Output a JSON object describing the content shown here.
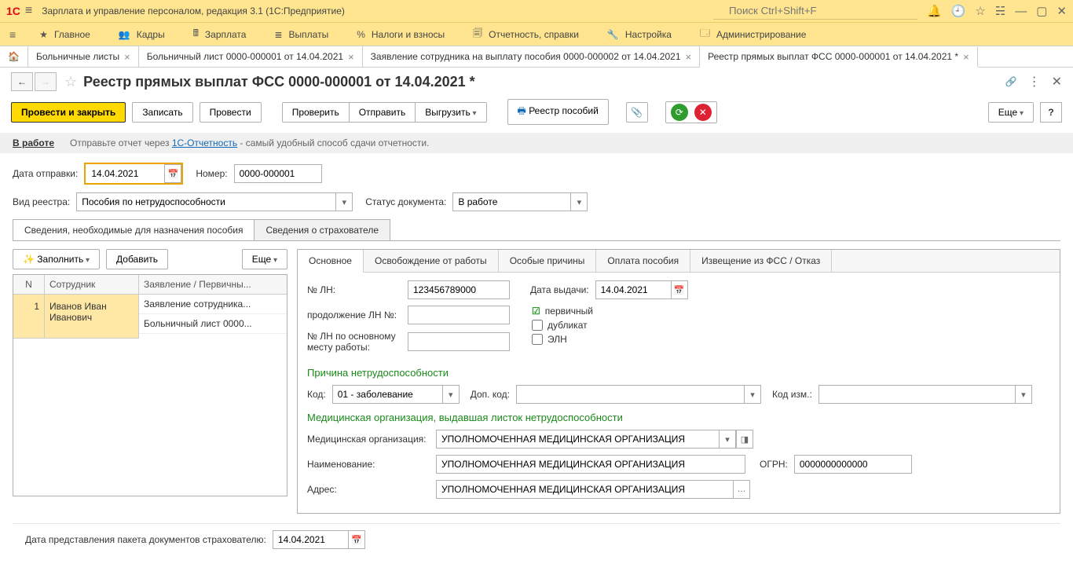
{
  "title_bar": {
    "logo": "1C",
    "app_title": "Зарплата и управление персоналом, редакция 3.1  (1С:Предприятие)",
    "search_placeholder": "Поиск Ctrl+Shift+F"
  },
  "main_menu": [
    {
      "icon": "★",
      "label": "Главное"
    },
    {
      "icon": "👥",
      "label": "Кадры"
    },
    {
      "icon": "🖩",
      "label": "Зарплата"
    },
    {
      "icon": "≣",
      "label": "Выплаты"
    },
    {
      "icon": "%",
      "label": "Налоги и взносы"
    },
    {
      "icon": "🗐",
      "label": "Отчетность, справки"
    },
    {
      "icon": "🔧",
      "label": "Настройка"
    },
    {
      "icon": "🗔",
      "label": "Администрирование"
    }
  ],
  "tabs": [
    {
      "label": "Больничные листы"
    },
    {
      "label": "Больничный лист 0000-000001 от 14.04.2021"
    },
    {
      "label": "Заявление сотрудника на выплату пособия 0000-000002 от 14.04.2021"
    },
    {
      "label": "Реестр прямых выплат ФСС 0000-000001 от 14.04.2021 *",
      "active": true
    }
  ],
  "page": {
    "title": "Реестр прямых выплат ФСС 0000-000001 от 14.04.2021 *"
  },
  "toolbar": {
    "btn_post_close": "Провести и закрыть",
    "btn_write": "Записать",
    "btn_post": "Провести",
    "btn_check": "Проверить",
    "btn_send": "Отправить",
    "btn_export": "Выгрузить",
    "btn_registry": "Реестр пособий",
    "btn_more": "Еще"
  },
  "banner": {
    "status": "В работе",
    "text_pre": "Отправьте отчет через ",
    "link": "1С-Отчетность",
    "text_post": " - самый удобный способ сдачи отчетности."
  },
  "header_form": {
    "lbl_send_date": "Дата отправки:",
    "send_date": "14.04.2021",
    "lbl_number": "Номер:",
    "number": "0000-000001",
    "lbl_registry_type": "Вид реестра:",
    "registry_type": "Пособия по нетрудоспособности",
    "lbl_doc_status": "Статус документа:",
    "doc_status": "В работе"
  },
  "section_tabs": {
    "tab1": "Сведения, необходимые для назначения пособия",
    "tab2": "Сведения о страхователе"
  },
  "left_toolbar": {
    "btn_fill": "Заполнить",
    "btn_add": "Добавить",
    "btn_more": "Еще"
  },
  "left_table": {
    "col_n": "N",
    "col_emp": "Сотрудник",
    "col_doc": "Заявление / Первичны...",
    "row_n": "1",
    "row_emp": "Иванов Иван Иванович",
    "row_doc1": "Заявление сотрудника...",
    "row_doc2": "Больничный лист 0000..."
  },
  "inner_tabs": {
    "t1": "Основное",
    "t2": "Освобождение от работы",
    "t3": "Особые причины",
    "t4": "Оплата пособия",
    "t5": "Извещение из ФСС / Отказ"
  },
  "main_form": {
    "lbl_ln": "№ ЛН:",
    "ln": "123456789000",
    "lbl_issue_date": "Дата выдачи:",
    "issue_date": "14.04.2021",
    "lbl_cont_ln": "продолжение ЛН №:",
    "lbl_main_ln": "№ ЛН по основному месту работы:",
    "chk_primary": "первичный",
    "chk_duplicate": "дубликат",
    "chk_eln": "ЭЛН",
    "heading_reason": "Причина нетрудоспособности",
    "lbl_code": "Код:",
    "code": "01 - заболевание",
    "lbl_add_code": "Доп. код:",
    "lbl_code_chg": "Код изм.:",
    "heading_med": "Медицинская организация, выдавшая листок нетрудоспособности",
    "lbl_med_org": "Медицинская организация:",
    "med_org": "УПОЛНОМОЧЕННАЯ МЕДИЦИНСКАЯ ОРГАНИЗАЦИЯ",
    "lbl_name": "Наименование:",
    "name": "УПОЛНОМОЧЕННАЯ МЕДИЦИНСКАЯ ОРГАНИЗАЦИЯ",
    "lbl_ogrn": "ОГРН:",
    "ogrn": "0000000000000",
    "lbl_addr": "Адрес:",
    "addr": "УПОЛНОМОЧЕННАЯ МЕДИЦИНСКАЯ ОРГАНИЗАЦИЯ"
  },
  "footer": {
    "lbl_pkg_date": "Дата представления пакета документов страхователю:",
    "pkg_date": "14.04.2021"
  }
}
